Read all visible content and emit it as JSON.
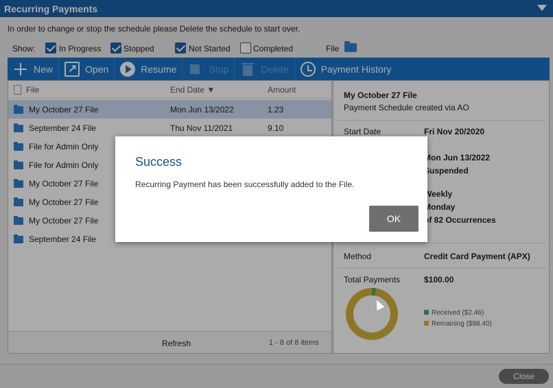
{
  "window": {
    "title": "Recurring Payments"
  },
  "info_text": "In order to change or stop the schedule please Delete the schedule to start over.",
  "filters": {
    "show_label": "Show:",
    "items": [
      {
        "label": "In Progress",
        "checked": true
      },
      {
        "label": "Stopped",
        "checked": true
      },
      {
        "label": "Not Started",
        "checked": true
      },
      {
        "label": "Completed",
        "checked": false
      }
    ],
    "file_label": "File"
  },
  "toolbar": {
    "new": "New",
    "open": "Open",
    "resume": "Resume",
    "stop": "Stop",
    "delete": "Delete",
    "history": "Payment History"
  },
  "table": {
    "columns": [
      "File",
      "End Date ▼",
      "Amount"
    ],
    "rows": [
      {
        "file": "My October 27 File",
        "end": "Mon Jun 13/2022",
        "amount": "1.23"
      },
      {
        "file": "September 24 File",
        "end": "Thu Nov 11/2021",
        "amount": "9.10"
      },
      {
        "file": "File for Admin Only",
        "end": "",
        "amount": ""
      },
      {
        "file": "File for Admin Only",
        "end": "",
        "amount": ""
      },
      {
        "file": "My October 27 File",
        "end": "",
        "amount": ""
      },
      {
        "file": "My October 27 File",
        "end": "",
        "amount": ""
      },
      {
        "file": "My October 27 File",
        "end": "",
        "amount": ""
      },
      {
        "file": "September 24 File",
        "end": "",
        "amount": ""
      }
    ],
    "refresh": "Refresh",
    "pager": "1 - 8 of 8 items"
  },
  "detail": {
    "file_name": "My October 27 File",
    "subtitle": "Payment Schedule created via AO",
    "start_date_label": "Start Date",
    "start_date": "Fri Nov 20/2020",
    "end_date": "Mon Jun 13/2022",
    "status": "Suspended",
    "frequency": "Weekly",
    "day": "Monday",
    "occurrences": "of 82 Occurrences",
    "method_label": "Method",
    "method": "Credit Card Payment (APX)",
    "total_label": "Total Payments",
    "total": "$100.00",
    "legend_received": "Received ($2.46)",
    "legend_remaining": "Remaining ($98.40)",
    "received_value": 2.46,
    "remaining_value": 98.4
  },
  "close_button": "Close",
  "dialog": {
    "title": "Success",
    "message": "Recurring Payment has been successfully added to the File.",
    "ok": "OK"
  },
  "colors": {
    "accent": "#1a73c5",
    "received": "#4aa664",
    "remaining": "#d4b13c"
  }
}
